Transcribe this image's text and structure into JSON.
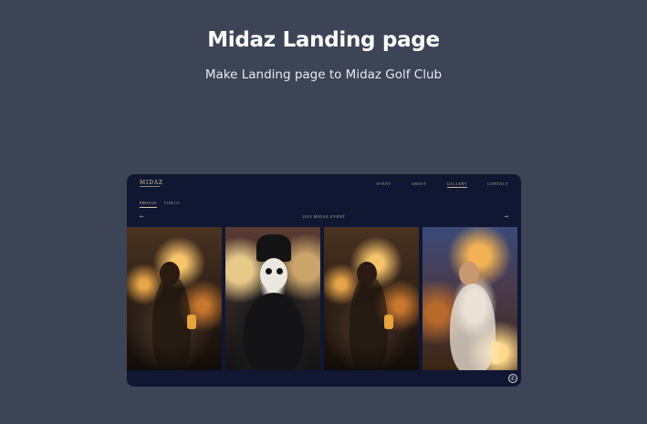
{
  "header": {
    "title": "Midaz Landing page",
    "subtitle": "Make Landing page to Midaz Golf Club"
  },
  "mockup": {
    "logo": "MIDAZ",
    "nav": [
      "EVENT",
      "ABOUT",
      "GALLERY",
      "CONTACT"
    ],
    "active_nav": "GALLERY",
    "tabs": [
      "PHOTOS",
      "VIDEOS"
    ],
    "active_tab": "PHOTOS",
    "gallery_title": "2023 MIDAZ EVENT",
    "prev_icon": "arrow-left-icon",
    "next_icon": "arrow-right-icon",
    "photos": [
      {
        "scene": "party-crowd-warm-lights"
      },
      {
        "scene": "costume-party-skull-makeup"
      },
      {
        "scene": "party-crowd-warm-lights"
      },
      {
        "scene": "celebration-sparklers"
      }
    ],
    "chat_icon": "whatsapp-icon"
  }
}
